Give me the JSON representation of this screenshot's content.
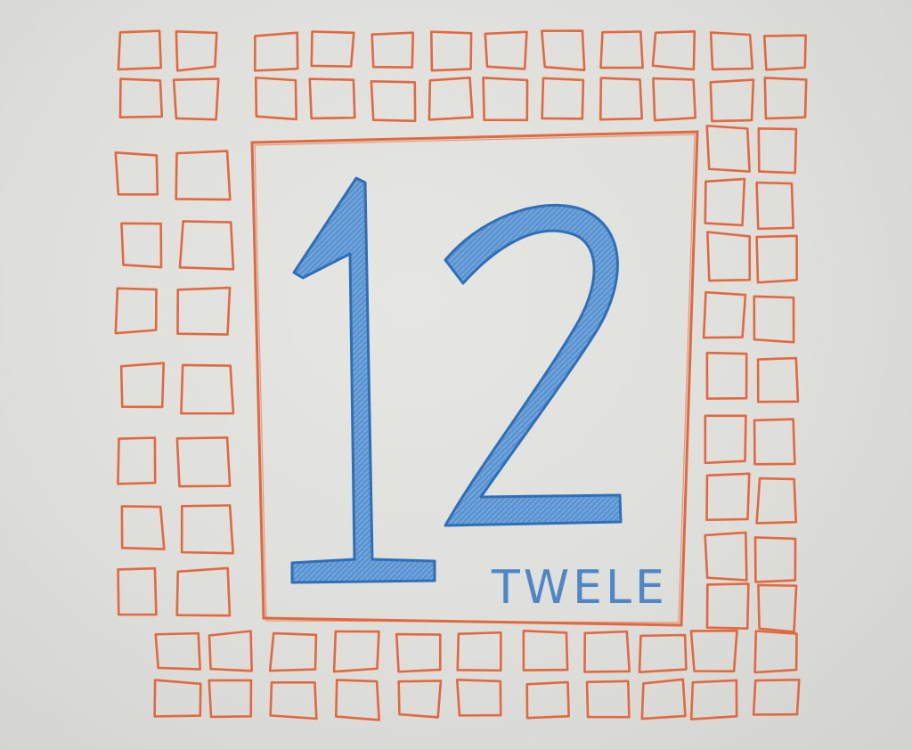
{
  "drawing": {
    "numeral": "12",
    "word": "TWELE"
  },
  "colors": {
    "paper": "#e2e2de",
    "frame": "#e2683f",
    "numeral": "#4a86c8",
    "numeral_outline": "#2f6fb8",
    "word": "#4f86c6"
  }
}
